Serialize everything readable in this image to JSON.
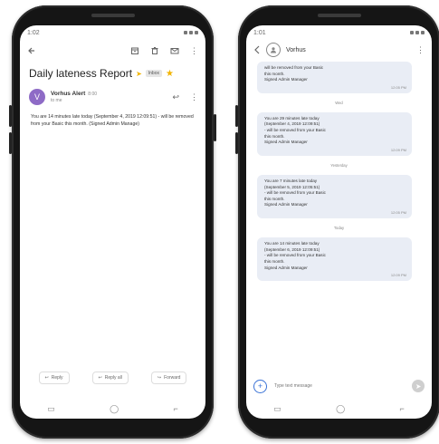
{
  "left_phone": {
    "status_time": "1:02",
    "subject": "Daily lateness Report",
    "label": "Inbox",
    "sender_initial": "V",
    "sender_name": "Vorhus Alert",
    "sender_time": "8:00",
    "sender_to": "to me",
    "body": "You are 14 minutes late today (September 4, 2019 12:09:51) - will be removed from your Basic this month. (Signed Admin Manage)",
    "actions": {
      "reply": "Reply",
      "reply_all": "Reply all",
      "forward": "Forward"
    }
  },
  "right_phone": {
    "status_time": "1:01",
    "contact_name": "Vorhus",
    "messages": [
      {
        "date": "",
        "lines": [
          "will be removed from your Basic",
          "this month.",
          "Signed Admin Manager"
        ],
        "time": "12:05 PM"
      },
      {
        "date": "Wed",
        "lines": [
          "You are 29 minutes late today",
          "(September 4, 2019 12:09:51)",
          "- will be removed from your Basic",
          "this month.",
          "Signed Admin Manager"
        ],
        "time": "12:09 PM"
      },
      {
        "date": "Yesterday",
        "lines": [
          "You are 7 minutes late today",
          "(September 5, 2019 12:05:51)",
          "- will be removed from your Basic",
          "this month.",
          "Signed Admin Manager"
        ],
        "time": "12:05 PM"
      },
      {
        "date": "Today",
        "lines": [
          "You are 14 minutes late today",
          "(September 6, 2019 12:09:51)",
          "- will be removed from your Basic",
          "this month.",
          "Signed Admin Manager"
        ],
        "time": "12:09 PM"
      }
    ],
    "composer_placeholder": "Type text message"
  },
  "colors": {
    "avatar": "#8e6bc6",
    "bubble": "#e9edf5",
    "accent": "#3a72d6",
    "star": "#f2b400"
  }
}
